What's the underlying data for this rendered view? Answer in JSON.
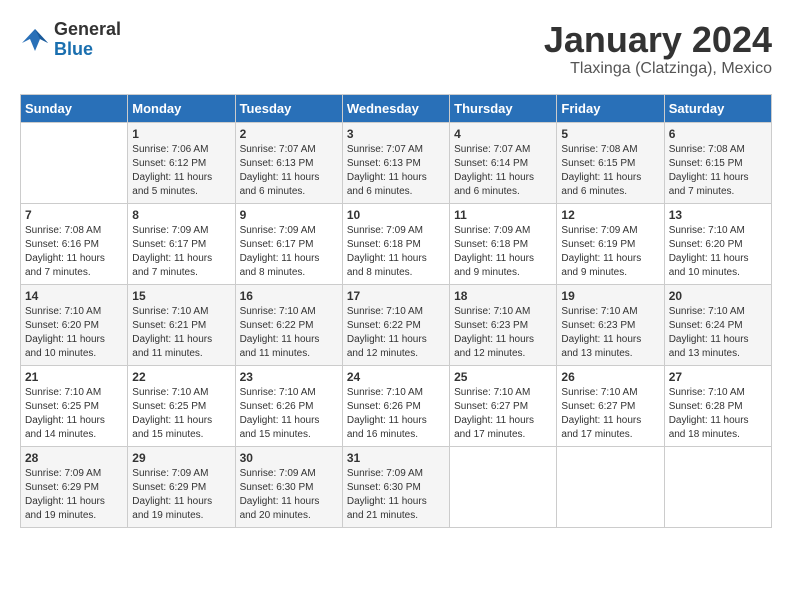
{
  "logo": {
    "general": "General",
    "blue": "Blue"
  },
  "title": "January 2024",
  "subtitle": "Tlaxinga (Clatzinga), Mexico",
  "days_header": [
    "Sunday",
    "Monday",
    "Tuesday",
    "Wednesday",
    "Thursday",
    "Friday",
    "Saturday"
  ],
  "weeks": [
    [
      {
        "day": "",
        "sunrise": "",
        "sunset": "",
        "daylight": ""
      },
      {
        "day": "1",
        "sunrise": "Sunrise: 7:06 AM",
        "sunset": "Sunset: 6:12 PM",
        "daylight": "Daylight: 11 hours and 5 minutes."
      },
      {
        "day": "2",
        "sunrise": "Sunrise: 7:07 AM",
        "sunset": "Sunset: 6:13 PM",
        "daylight": "Daylight: 11 hours and 6 minutes."
      },
      {
        "day": "3",
        "sunrise": "Sunrise: 7:07 AM",
        "sunset": "Sunset: 6:13 PM",
        "daylight": "Daylight: 11 hours and 6 minutes."
      },
      {
        "day": "4",
        "sunrise": "Sunrise: 7:07 AM",
        "sunset": "Sunset: 6:14 PM",
        "daylight": "Daylight: 11 hours and 6 minutes."
      },
      {
        "day": "5",
        "sunrise": "Sunrise: 7:08 AM",
        "sunset": "Sunset: 6:15 PM",
        "daylight": "Daylight: 11 hours and 6 minutes."
      },
      {
        "day": "6",
        "sunrise": "Sunrise: 7:08 AM",
        "sunset": "Sunset: 6:15 PM",
        "daylight": "Daylight: 11 hours and 7 minutes."
      }
    ],
    [
      {
        "day": "7",
        "sunrise": "Sunrise: 7:08 AM",
        "sunset": "Sunset: 6:16 PM",
        "daylight": "Daylight: 11 hours and 7 minutes."
      },
      {
        "day": "8",
        "sunrise": "Sunrise: 7:09 AM",
        "sunset": "Sunset: 6:17 PM",
        "daylight": "Daylight: 11 hours and 7 minutes."
      },
      {
        "day": "9",
        "sunrise": "Sunrise: 7:09 AM",
        "sunset": "Sunset: 6:17 PM",
        "daylight": "Daylight: 11 hours and 8 minutes."
      },
      {
        "day": "10",
        "sunrise": "Sunrise: 7:09 AM",
        "sunset": "Sunset: 6:18 PM",
        "daylight": "Daylight: 11 hours and 8 minutes."
      },
      {
        "day": "11",
        "sunrise": "Sunrise: 7:09 AM",
        "sunset": "Sunset: 6:18 PM",
        "daylight": "Daylight: 11 hours and 9 minutes."
      },
      {
        "day": "12",
        "sunrise": "Sunrise: 7:09 AM",
        "sunset": "Sunset: 6:19 PM",
        "daylight": "Daylight: 11 hours and 9 minutes."
      },
      {
        "day": "13",
        "sunrise": "Sunrise: 7:10 AM",
        "sunset": "Sunset: 6:20 PM",
        "daylight": "Daylight: 11 hours and 10 minutes."
      }
    ],
    [
      {
        "day": "14",
        "sunrise": "Sunrise: 7:10 AM",
        "sunset": "Sunset: 6:20 PM",
        "daylight": "Daylight: 11 hours and 10 minutes."
      },
      {
        "day": "15",
        "sunrise": "Sunrise: 7:10 AM",
        "sunset": "Sunset: 6:21 PM",
        "daylight": "Daylight: 11 hours and 11 minutes."
      },
      {
        "day": "16",
        "sunrise": "Sunrise: 7:10 AM",
        "sunset": "Sunset: 6:22 PM",
        "daylight": "Daylight: 11 hours and 11 minutes."
      },
      {
        "day": "17",
        "sunrise": "Sunrise: 7:10 AM",
        "sunset": "Sunset: 6:22 PM",
        "daylight": "Daylight: 11 hours and 12 minutes."
      },
      {
        "day": "18",
        "sunrise": "Sunrise: 7:10 AM",
        "sunset": "Sunset: 6:23 PM",
        "daylight": "Daylight: 11 hours and 12 minutes."
      },
      {
        "day": "19",
        "sunrise": "Sunrise: 7:10 AM",
        "sunset": "Sunset: 6:23 PM",
        "daylight": "Daylight: 11 hours and 13 minutes."
      },
      {
        "day": "20",
        "sunrise": "Sunrise: 7:10 AM",
        "sunset": "Sunset: 6:24 PM",
        "daylight": "Daylight: 11 hours and 13 minutes."
      }
    ],
    [
      {
        "day": "21",
        "sunrise": "Sunrise: 7:10 AM",
        "sunset": "Sunset: 6:25 PM",
        "daylight": "Daylight: 11 hours and 14 minutes."
      },
      {
        "day": "22",
        "sunrise": "Sunrise: 7:10 AM",
        "sunset": "Sunset: 6:25 PM",
        "daylight": "Daylight: 11 hours and 15 minutes."
      },
      {
        "day": "23",
        "sunrise": "Sunrise: 7:10 AM",
        "sunset": "Sunset: 6:26 PM",
        "daylight": "Daylight: 11 hours and 15 minutes."
      },
      {
        "day": "24",
        "sunrise": "Sunrise: 7:10 AM",
        "sunset": "Sunset: 6:26 PM",
        "daylight": "Daylight: 11 hours and 16 minutes."
      },
      {
        "day": "25",
        "sunrise": "Sunrise: 7:10 AM",
        "sunset": "Sunset: 6:27 PM",
        "daylight": "Daylight: 11 hours and 17 minutes."
      },
      {
        "day": "26",
        "sunrise": "Sunrise: 7:10 AM",
        "sunset": "Sunset: 6:27 PM",
        "daylight": "Daylight: 11 hours and 17 minutes."
      },
      {
        "day": "27",
        "sunrise": "Sunrise: 7:10 AM",
        "sunset": "Sunset: 6:28 PM",
        "daylight": "Daylight: 11 hours and 18 minutes."
      }
    ],
    [
      {
        "day": "28",
        "sunrise": "Sunrise: 7:09 AM",
        "sunset": "Sunset: 6:29 PM",
        "daylight": "Daylight: 11 hours and 19 minutes."
      },
      {
        "day": "29",
        "sunrise": "Sunrise: 7:09 AM",
        "sunset": "Sunset: 6:29 PM",
        "daylight": "Daylight: 11 hours and 19 minutes."
      },
      {
        "day": "30",
        "sunrise": "Sunrise: 7:09 AM",
        "sunset": "Sunset: 6:30 PM",
        "daylight": "Daylight: 11 hours and 20 minutes."
      },
      {
        "day": "31",
        "sunrise": "Sunrise: 7:09 AM",
        "sunset": "Sunset: 6:30 PM",
        "daylight": "Daylight: 11 hours and 21 minutes."
      },
      {
        "day": "",
        "sunrise": "",
        "sunset": "",
        "daylight": ""
      },
      {
        "day": "",
        "sunrise": "",
        "sunset": "",
        "daylight": ""
      },
      {
        "day": "",
        "sunrise": "",
        "sunset": "",
        "daylight": ""
      }
    ]
  ]
}
